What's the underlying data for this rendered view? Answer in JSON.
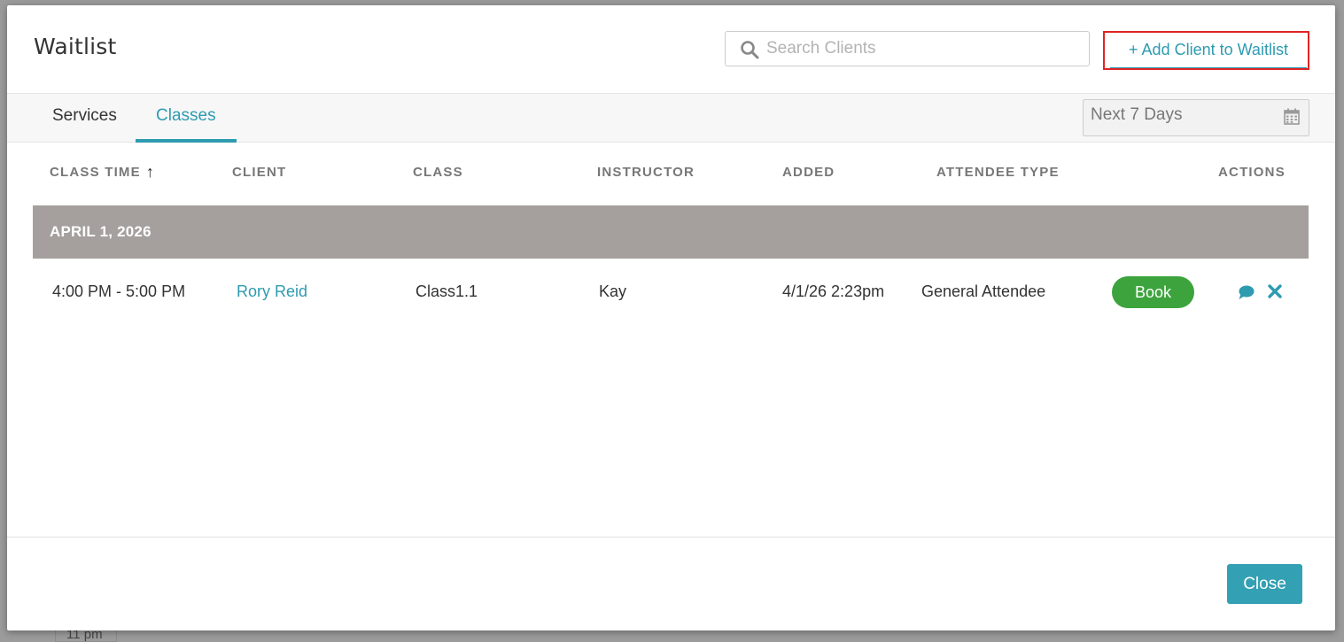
{
  "background": {
    "time_label": "11 pm"
  },
  "modal": {
    "title": "Waitlist",
    "search": {
      "placeholder": "Search Clients",
      "value": "",
      "icon": "search-icon"
    },
    "add_client_label": "+ Add Client to Waitlist",
    "tabs": [
      {
        "label": "Services",
        "active": false
      },
      {
        "label": "Classes",
        "active": true
      }
    ],
    "date_range": {
      "value": "Next 7 Days",
      "icon": "calendar-icon"
    },
    "columns": {
      "class_time": "CLASS TIME",
      "client": "CLIENT",
      "class": "CLASS",
      "instructor": "INSTRUCTOR",
      "added": "ADDED",
      "attendee_type": "ATTENDEE TYPE",
      "actions": "ACTIONS"
    },
    "sort": {
      "column": "class_time",
      "direction": "ascending"
    },
    "groups": [
      {
        "date": "APRIL 1, 2026",
        "rows": [
          {
            "class_time": "4:00 PM - 5:00 PM",
            "client": "Rory Reid",
            "class": "Class1.1",
            "instructor": "Kay",
            "added": "4/1/26 2:23pm",
            "attendee_type": "General Attendee",
            "book_label": "Book"
          }
        ]
      }
    ],
    "close_label": "Close"
  },
  "colors": {
    "accent": "#2e9bb0",
    "book_green": "#3da43d",
    "group_header": "#a59f9e",
    "highlight_border": "#e02424"
  }
}
